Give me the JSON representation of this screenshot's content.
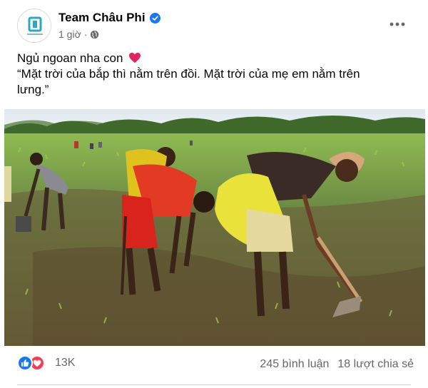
{
  "post": {
    "page_name": "Team Châu Phi",
    "time": "1 giờ",
    "separator": "·",
    "privacy_icon": "globe-icon",
    "verified_icon": "verified-badge-icon",
    "more_icon": "more-options-icon",
    "avatar_icon": "page-logo-icon",
    "text_line1": "Ngủ ngoan nha con",
    "text_emoji": "red-heart-icon",
    "text_line2": "“Mặt trời của bắp thì nằm trên đồi. Mặt trời của mẹ em nằm trên",
    "text_line3": "lưng.”"
  },
  "stats": {
    "reaction_icons": [
      "like-icon",
      "love-icon"
    ],
    "reaction_count": "13K",
    "comments": "245 bình luận",
    "shares": "18 lượt chia sẻ"
  },
  "colors": {
    "accent": "#1877f2",
    "love": "#f33e58",
    "secondary_text": "#65676b",
    "primary_text": "#050505"
  }
}
